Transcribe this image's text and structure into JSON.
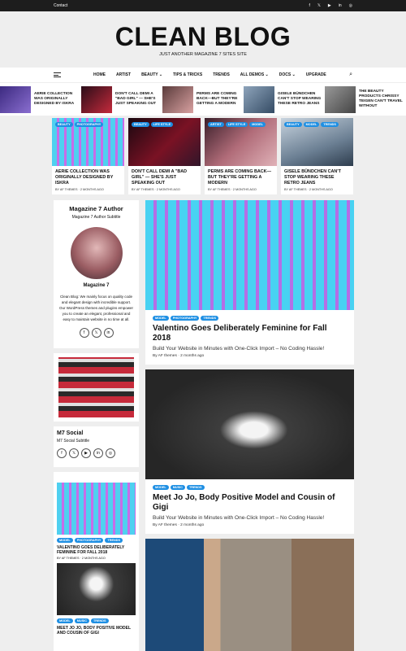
{
  "topbar": {
    "contact": "Contact",
    "icons": [
      "facebook-icon",
      "x-icon",
      "youtube-icon",
      "linkedin-icon",
      "instagram-icon"
    ]
  },
  "header": {
    "logo": "CLEAN BLOG",
    "tagline": "JUST ANOTHER MAGAZINE 7 SITES SITE"
  },
  "nav": {
    "items": [
      "HOME",
      "ARTIST",
      "BEAUTY ⌄",
      "TIPS & TRICKS",
      "TRENDS",
      "ALL DEMOS ⌄",
      "DOCS ⌄",
      "UPGRADE"
    ]
  },
  "ticker": [
    {
      "title": "AERIE COLLECTION WAS ORIGINALLY DESIGNED BY ISKRA",
      "color": "#5b4aa0"
    },
    {
      "title": "DON'T CALL DEMI A \"BAD GIRL\" — SHE'S JUST SPEAKING OUT",
      "color": "#8a1a2b"
    },
    {
      "title": "PERMS ARE COMING BACK—BUT THEY'RE GETTING A MODERN",
      "color": "#b07070"
    },
    {
      "title": "GISELE BÜNDCHEN CAN'T STOP WEARING THESE RETRO JEANS",
      "color": "#5d7890"
    },
    {
      "title": "THE BEAUTY PRODUCTS CHRISSY TEIGEN CAN'T TRAVEL WITHOUT",
      "color": "#777"
    }
  ],
  "featured": [
    {
      "cats": [
        "BEAUTY",
        "PHOTOGRAPHY"
      ],
      "title": "AERIE COLLECTION WAS ORIGINALLY DESIGNED BY ISKRA",
      "meta": "BY AF THEMES  ·  2 MONTHS AGO"
    },
    {
      "cats": [
        "BEAUTY",
        "LIFE STYLE"
      ],
      "title": "DON'T CALL DEMI A \"BAD GIRL\" — SHE'S JUST SPEAKING OUT",
      "meta": "BY AF THEMES  ·  2 MONTHS AGO"
    },
    {
      "cats": [
        "ARTIST",
        "LIFE STYLE",
        "MODEL"
      ],
      "title": "PERMS ARE COMING BACK—BUT THEY'RE GETTING A MODERN",
      "meta": "BY AF THEMES  ·  2 MONTHS AGO"
    },
    {
      "cats": [
        "BEAUTY",
        "MODEL",
        "TRENDS"
      ],
      "title": "GISELE BÜNDCHEN CAN'T STOP WEARING THESE RETRO JEANS",
      "meta": "BY AF THEMES  ·  2 MONTHS AGO"
    }
  ],
  "author_widget": {
    "title": "Magazine 7 Author",
    "subtitle": "Magazine 7 Author Subtitle",
    "name": "Magazine 7",
    "description": "Clean Blog: We mainly focus on quality code and elegant design with incredible support. Our WordPress themes and plugins empower you to create an elegant, professional and easy to maintain website in no time at all.",
    "icons": [
      "f",
      "𝕏",
      "in"
    ]
  },
  "social_widget": {
    "title": "M7 Social",
    "subtitle": "M7 Social Subtitle",
    "icons": [
      "f",
      "𝕏",
      "▶",
      "in",
      "◎"
    ]
  },
  "side_posts": [
    {
      "cats": [
        "MODEL",
        "PHOTOGRAPHY",
        "TRENDS"
      ],
      "title": "VALENTINO GOES DELIBERATELY FEMININE FOR FALL 2018",
      "meta": "BY AF THEMES  ·  2 MONTHS AGO"
    },
    {
      "cats": [
        "MODEL",
        "MUSIC",
        "TRENDS"
      ],
      "title": "MEET JO JO, BODY POSITIVE MODEL AND COUSIN OF GIGI",
      "meta": ""
    }
  ],
  "posts": [
    {
      "cats": [
        "MODEL",
        "PHOTOGRAPHY",
        "TRENDS"
      ],
      "title": "Valentino Goes Deliberately Feminine for Fall 2018",
      "excerpt": "Build Your Website in Minutes with One-Click Import – No Coding Hassle!",
      "meta": "By AF themes  ·  2 months ago"
    },
    {
      "cats": [
        "MODEL",
        "MUSIC",
        "TRENDS"
      ],
      "title": "Meet Jo Jo, Body Positive Model and Cousin of Gigi",
      "excerpt": "Build Your Website in Minutes with One-Click Import – No Coding Hassle!",
      "meta": "By AF themes  ·  2 months ago"
    },
    {
      "cats": [],
      "title": "",
      "excerpt": "",
      "meta": ""
    }
  ]
}
